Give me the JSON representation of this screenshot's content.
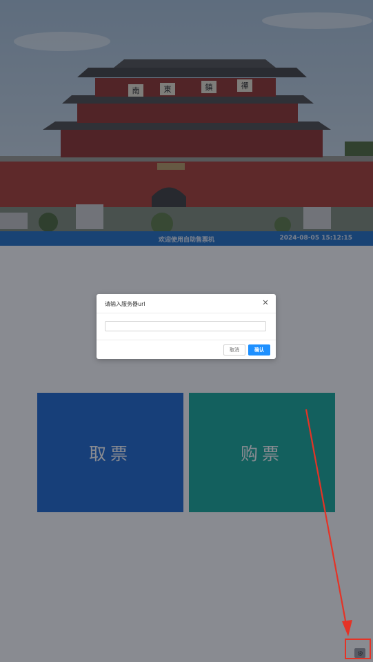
{
  "header": {
    "banner_alt": "city gate tower photo",
    "sign_chars": [
      "南",
      "東",
      "鎮",
      "禪"
    ],
    "welcome_text": "欢迎使用自助售票机",
    "datetime": "2024-08-05 15:12:15"
  },
  "tiles": {
    "take_ticket": "取票",
    "buy_ticket": "购票"
  },
  "dialog": {
    "title": "请输入服务器url",
    "input_value": "",
    "input_placeholder": "",
    "cancel_label": "取消",
    "confirm_label": "确认"
  },
  "settings": {
    "icon": "gear-icon"
  },
  "annotation": {
    "color": "#e53326"
  },
  "colors": {
    "status_bar": "#1f6fc4",
    "take_tile": "#1b66cf",
    "buy_tile": "#12a999",
    "confirm": "#1e90ff"
  }
}
